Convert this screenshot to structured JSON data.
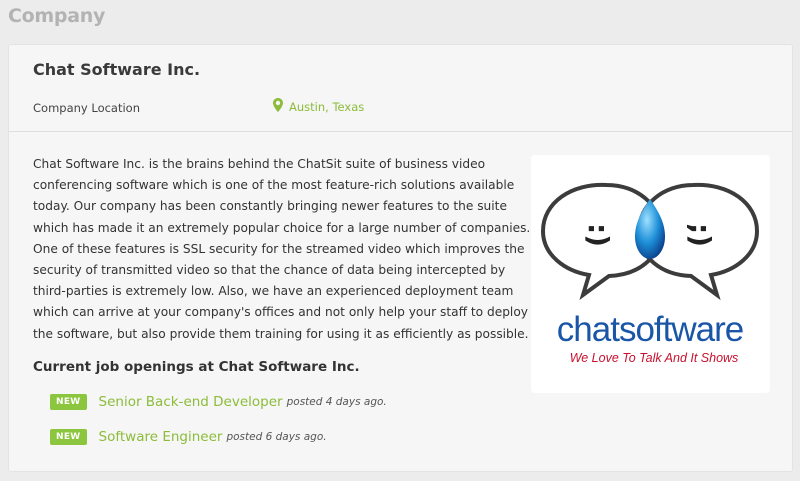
{
  "section": {
    "title": "Company"
  },
  "company": {
    "name": "Chat Software Inc.",
    "location_label": "Company Location",
    "location_value": "Austin, Texas",
    "description": "Chat Software Inc. is the brains behind the ChatSit suite of business video conferencing software which is one of the most feature-rich solutions available today. Our company has been constantly bringing newer features to the suite which has made it an extremely popular choice for a large number of companies. One of these features is SSL security for the streamed video which improves the security of transmitted video so that the chance of data being intercepted by third-parties is extremely low. Also, we have an experienced deployment team which can arrive at your company's offices and not only help your staff to deploy the software, but also provide them training for using it as efficiently as possible.",
    "logo": {
      "left_face": ":)",
      "right_face": ";)",
      "word_chat": "chat",
      "word_software": "software",
      "tagline": "We Love To Talk And It Shows"
    }
  },
  "openings": {
    "title": "Current job openings at Chat Software Inc.",
    "jobs": [
      {
        "badge": "NEW",
        "title": "Senior Back-end Developer",
        "posted": "posted 4 days ago."
      },
      {
        "badge": "NEW",
        "title": "Software Engineer",
        "posted": "posted 6 days ago."
      }
    ]
  },
  "colors": {
    "accent_green": "#8cbc3a",
    "badge_green": "#8cc63f",
    "logo_blue": "#1a56a8",
    "logo_red": "#c8102e"
  }
}
